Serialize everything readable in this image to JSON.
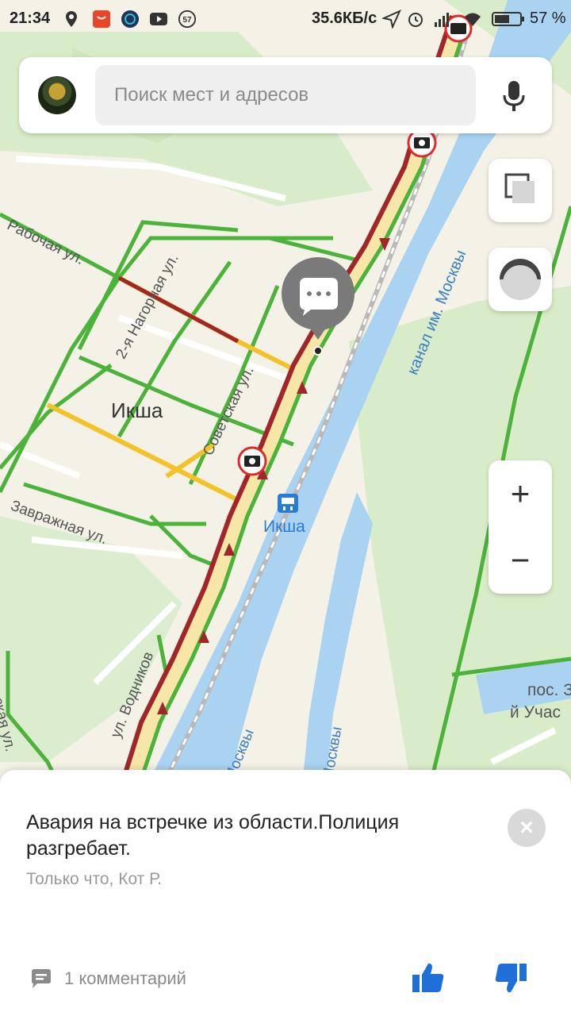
{
  "status_bar": {
    "time": "21:34",
    "notification_badge": "57",
    "network_speed": "35.6КБ/с",
    "battery": "57 %"
  },
  "search": {
    "placeholder": "Поиск мест и адресов"
  },
  "map": {
    "labels": {
      "street_rabochaya": "Рабочая ул.",
      "street_nagornaya": "2-я Нагорная ул.",
      "town": "Икша",
      "street_sovetskaya": "Советская ул.",
      "station": "Икша",
      "street_zavrazhnaya": "Завражная ул.",
      "street_vodnikov": "ул. Водников",
      "canal": "канал им. Москвы",
      "river_a": "Москвы",
      "river_b": "Москвы",
      "settlement_a": "пос. З",
      "settlement_b": "й Учас",
      "street_edge": "ская ул."
    },
    "colors": {
      "water": "#a9d3f0",
      "green": "#4cb33a",
      "jam": "#a0262a",
      "slow": "#f3c228",
      "road_base": "#f6e6a8"
    }
  },
  "controls": {
    "zoom_in": "+",
    "zoom_out": "−"
  },
  "event": {
    "message": "Авария на встречке из области.Полиция разгребает.",
    "meta": "Только что, Кот Р.",
    "comments": "1 комментарий",
    "close": "×"
  }
}
